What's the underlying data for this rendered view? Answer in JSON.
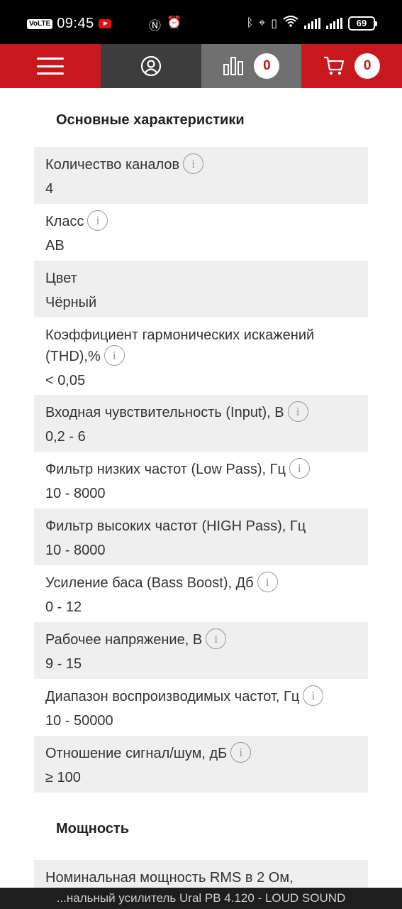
{
  "status_bar": {
    "volte": "VoLTE",
    "time": "09:45",
    "battery": "69"
  },
  "nav": {
    "compare_count": "0",
    "cart_count": "0"
  },
  "sections": [
    {
      "title": "Основные характеристики",
      "specs": [
        {
          "label": "Количество каналов",
          "value": "4",
          "info": true
        },
        {
          "label": "Класс",
          "value": "АВ",
          "info": true
        },
        {
          "label": "Цвет",
          "value": "Чёрный",
          "info": false
        },
        {
          "label_line1": "Коэффициент гармонических искажений",
          "label_line2": "(THD),%",
          "value": "< 0,05",
          "info": true
        },
        {
          "label": "Входная чувствительность (Input), В",
          "value": "0,2 - 6",
          "info": true
        },
        {
          "label": "Фильтр низких частот (Low Pass), Гц",
          "value": "10 - 8000",
          "info": true
        },
        {
          "label": "Фильтр высоких частот (HIGH Pass), Гц",
          "value": "10 - 8000",
          "info": false
        },
        {
          "label": "Усиление баса (Bass Boost), Дб",
          "value": "0 - 12",
          "info": true
        },
        {
          "label": "Рабочее напряжение, В",
          "value": "9 - 15",
          "info": true
        },
        {
          "label": "Диапазон воспроизводимых частот, Гц",
          "value": "10 - 50000",
          "info": true
        },
        {
          "label": "Отношение сигнал/шум, дБ",
          "value": "≥ 100",
          "info": true
        }
      ]
    },
    {
      "title": "Мощность",
      "specs": [
        {
          "label": "Номинальная мощность RMS в 2 Ом,",
          "value": "",
          "info": false
        }
      ]
    }
  ],
  "bottom_bar": {
    "text": "...нальный усилитель Ural PB 4.120 - LOUD SOUND"
  },
  "colors": {
    "brand_red": "#c7181e",
    "nav_dark": "#3d3d3d",
    "nav_gray": "#707070",
    "row_shade": "#efefef"
  },
  "icons": [
    "menu-icon",
    "user-icon",
    "compare-icon",
    "cart-icon",
    "info-icon"
  ]
}
